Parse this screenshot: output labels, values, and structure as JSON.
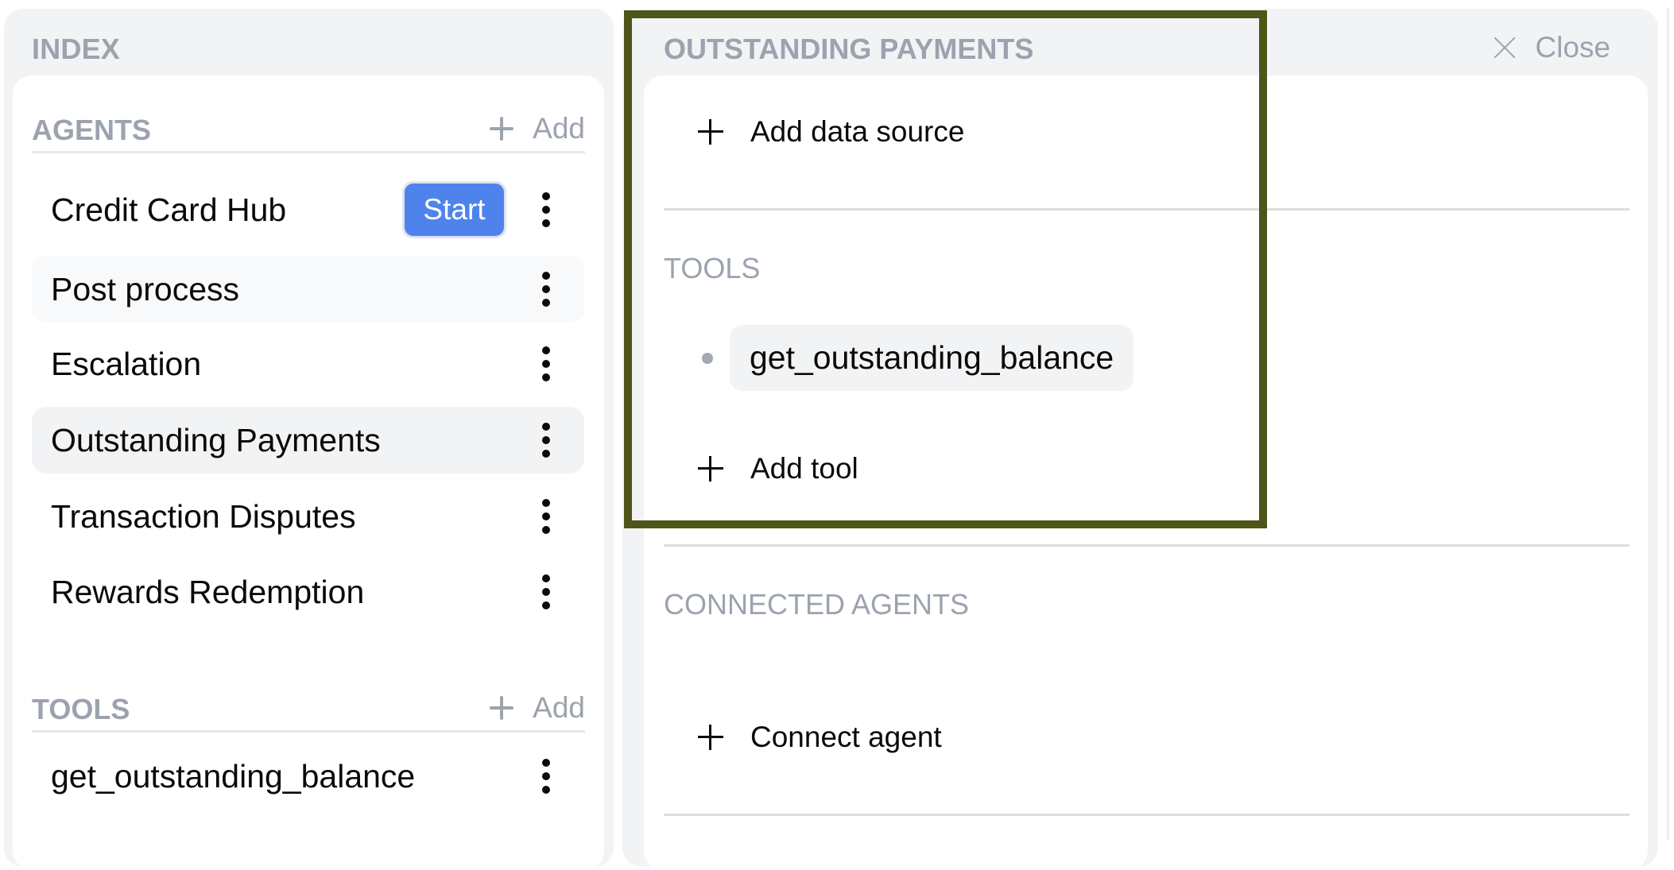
{
  "index_panel": {
    "title": "INDEX",
    "agents_section": {
      "label": "AGENTS",
      "add_label": "Add",
      "items": [
        {
          "name": "Credit Card Hub",
          "start_label": "Start",
          "state": "default"
        },
        {
          "name": "Post process",
          "state": "hover"
        },
        {
          "name": "Escalation",
          "state": "default"
        },
        {
          "name": "Outstanding Payments",
          "state": "selected"
        },
        {
          "name": "Transaction Disputes",
          "state": "default"
        },
        {
          "name": "Rewards Redemption",
          "state": "default"
        }
      ]
    },
    "tools_section": {
      "label": "TOOLS",
      "add_label": "Add",
      "items": [
        {
          "name": "get_outstanding_balance"
        }
      ]
    }
  },
  "detail_panel": {
    "title": "OUTSTANDING PAYMENTS",
    "close_label": "Close",
    "add_data_source_label": "Add data source",
    "tools_label": "TOOLS",
    "tools": [
      "get_outstanding_balance"
    ],
    "add_tool_label": "Add tool",
    "connected_agents_label": "CONNECTED AGENTS",
    "connect_agent_label": "Connect agent"
  },
  "colors": {
    "accent_blue": "#4f83ec",
    "highlight_olive": "#4f5418",
    "muted_text": "#9ca3af",
    "panel_bg": "#f2f3f5"
  }
}
